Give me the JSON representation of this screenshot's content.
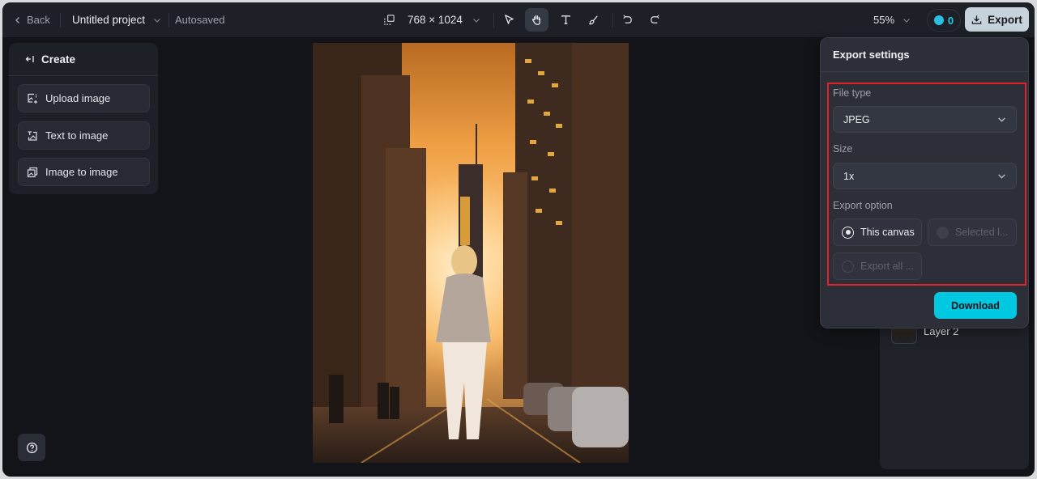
{
  "topbar": {
    "back_label": "Back",
    "project_title": "Untitled project",
    "save_status": "Autosaved",
    "canvas_size": "768 × 1024",
    "zoom_level": "55%",
    "credits": "0",
    "export_label": "Export"
  },
  "tools": [
    {
      "name": "select",
      "icon": "cursor-icon"
    },
    {
      "name": "hand",
      "icon": "hand-icon",
      "active": true
    },
    {
      "name": "text",
      "icon": "text-icon"
    },
    {
      "name": "brush",
      "icon": "brush-icon"
    },
    {
      "name": "undo",
      "icon": "undo-icon"
    },
    {
      "name": "redo",
      "icon": "redo-icon"
    }
  ],
  "create_panel": {
    "title": "Create",
    "items": [
      {
        "label": "Upload image",
        "icon": "upload-image-icon"
      },
      {
        "label": "Text to image",
        "icon": "text-to-image-icon"
      },
      {
        "label": "Image to image",
        "icon": "image-to-image-icon"
      }
    ]
  },
  "layers": [
    {
      "label": "Layer 2"
    }
  ],
  "export_settings": {
    "title": "Export settings",
    "file_type_label": "File type",
    "file_type_value": "JPEG",
    "size_label": "Size",
    "size_value": "1x",
    "export_option_label": "Export option",
    "options": [
      {
        "label": "This canvas",
        "selected": true,
        "disabled": false
      },
      {
        "label": "Selected l...",
        "selected": false,
        "disabled": true
      },
      {
        "label": "Export all ...",
        "selected": false,
        "disabled": true
      }
    ],
    "download_label": "Download"
  },
  "colors": {
    "accent": "#00c8e0",
    "highlight_border": "#e0222b",
    "export_button_bg": "#c7d3dc"
  }
}
